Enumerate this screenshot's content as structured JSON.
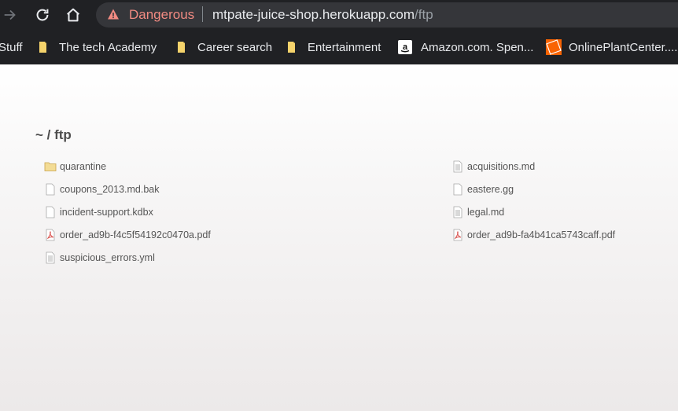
{
  "browser": {
    "security_label": "Dangerous",
    "url_host": "mtpate-juice-shop.herokuapp.com",
    "url_path": "/ftp"
  },
  "bookmarks": [
    {
      "label": "Stuff",
      "icon": "folder-icon"
    },
    {
      "label": "The tech Academy",
      "icon": "folder-icon"
    },
    {
      "label": "Career search",
      "icon": "folder-icon"
    },
    {
      "label": "Entertainment",
      "icon": "folder-icon"
    },
    {
      "label": "Amazon.com. Spen...",
      "icon": "amazon-favicon"
    },
    {
      "label": "OnlinePlantCenter....",
      "icon": "home-depot-favicon"
    }
  ],
  "listing": {
    "title": "~ / ftp",
    "left": [
      {
        "name": "quarantine",
        "type": "folder"
      },
      {
        "name": "coupons_2013.md.bak",
        "type": "file"
      },
      {
        "name": "incident-support.kdbx",
        "type": "file"
      },
      {
        "name": "order_ad9b-f4c5f54192c0470a.pdf",
        "type": "pdf"
      },
      {
        "name": "suspicious_errors.yml",
        "type": "text"
      }
    ],
    "right": [
      {
        "name": "acquisitions.md",
        "type": "text"
      },
      {
        "name": "eastere.gg",
        "type": "file"
      },
      {
        "name": "legal.md",
        "type": "text"
      },
      {
        "name": "order_ad9b-fa4b41ca5743caff.pdf",
        "type": "pdf"
      }
    ]
  },
  "colors": {
    "toolbar_bg": "#202124",
    "danger": "#f28b82",
    "folder": "#e8c56a",
    "pdf": "#d9534f"
  }
}
